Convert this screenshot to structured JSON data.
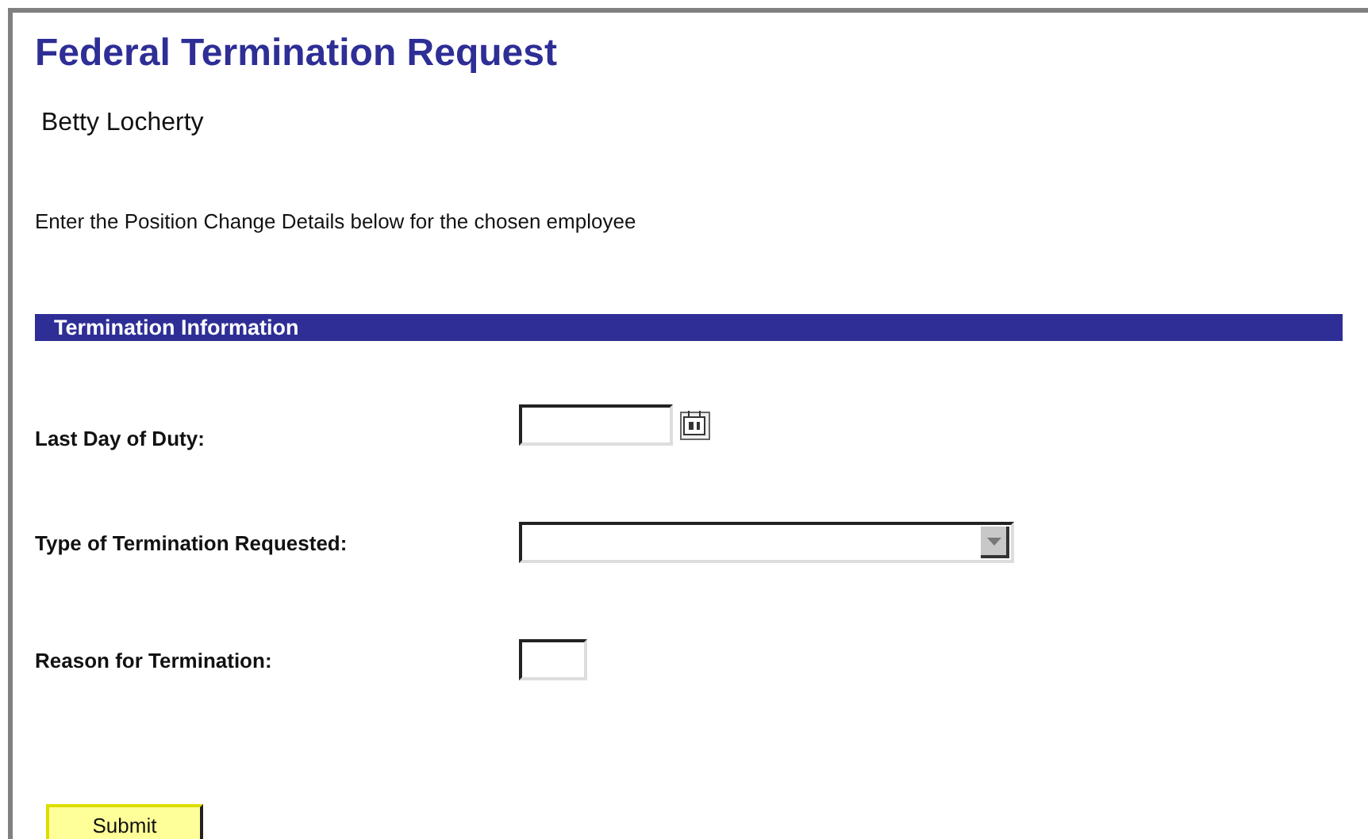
{
  "title": "Federal Termination Request",
  "employee_name": "Betty Locherty",
  "instruction": "Enter the Position Change Details below for the chosen employee",
  "section": {
    "title": "Termination Information"
  },
  "fields": [
    {
      "kind": "date",
      "label": "Last Day of Duty:"
    },
    {
      "kind": "select",
      "label": "Type of Termination Requested:"
    },
    {
      "kind": "short",
      "label": "Reason for Termination:"
    }
  ],
  "submit": "Submit"
}
